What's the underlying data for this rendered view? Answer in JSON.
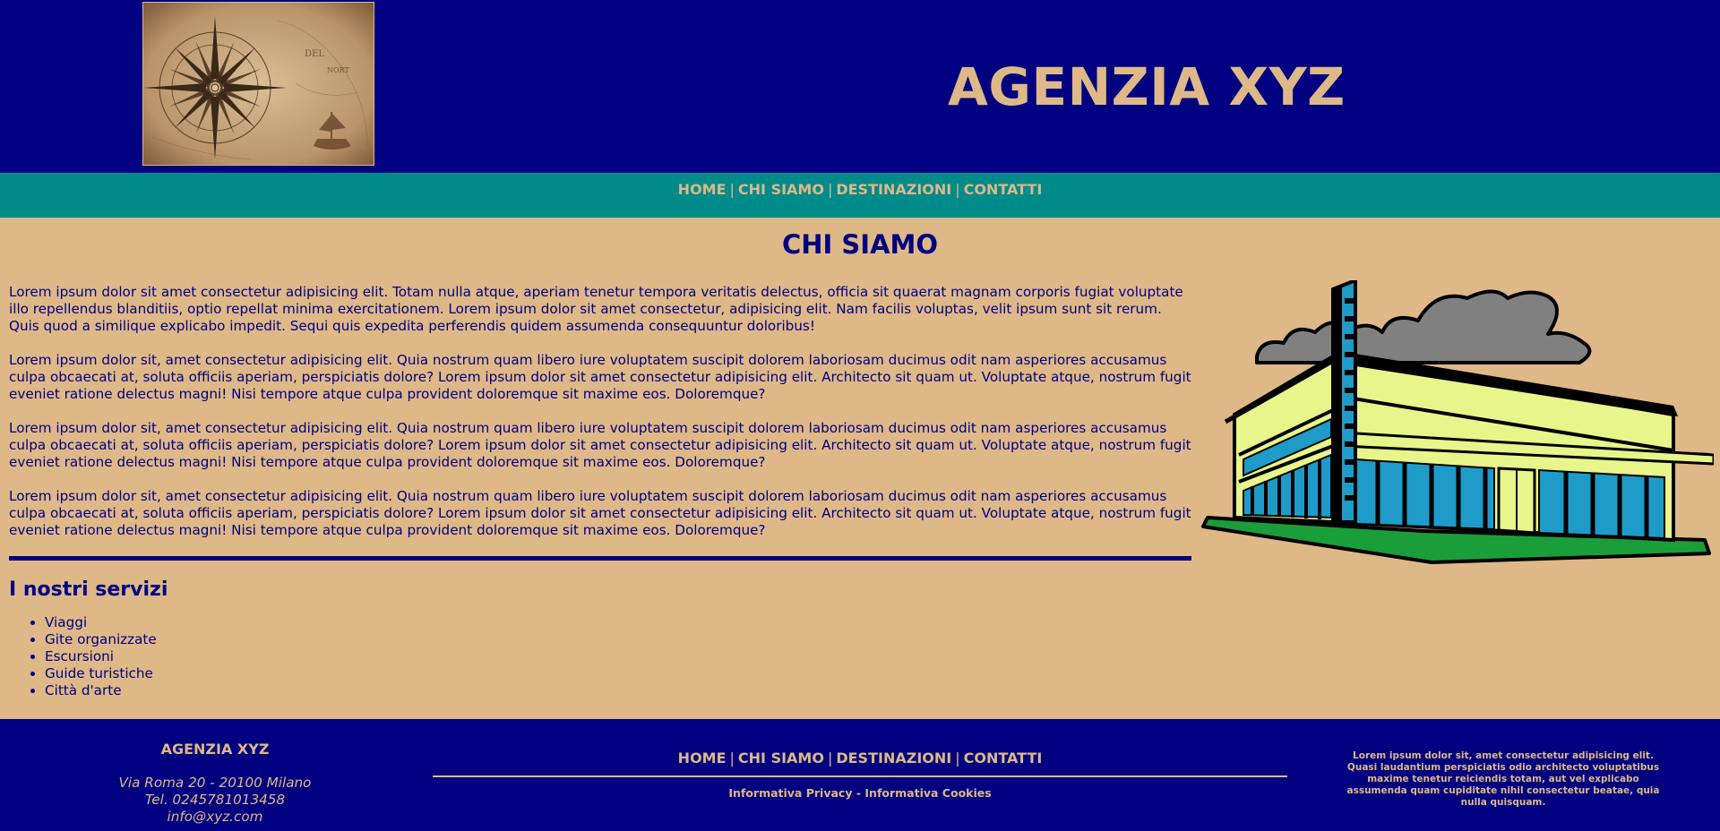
{
  "header": {
    "logo_icon": "compass-rose-map-image",
    "title": "AGENZIA XYZ"
  },
  "nav": {
    "home": "HOME",
    "about": "CHI SIAMO",
    "destinations": "DESTINAZIONI",
    "contacts": "CONTATTI",
    "separator": "|"
  },
  "main": {
    "heading": "CHI SIAMO",
    "paragraphs": [
      "Lorem ipsum dolor sit amet consectetur adipisicing elit. Totam nulla atque, aperiam tenetur tempora veritatis delectus, officia sit quaerat magnam corporis fugiat voluptate illo repellendus blanditiis, optio repellat minima exercitationem. Lorem ipsum dolor sit amet consectetur, adipisicing elit. Nam facilis voluptas, velit ipsum sunt sit rerum. Quis quod a similique explicabo impedit. Sequi quis expedita perferendis quidem assumenda consequuntur doloribus!",
      "Lorem ipsum dolor sit, amet consectetur adipisicing elit. Quia nostrum quam libero iure voluptatem suscipit dolorem laboriosam ducimus odit nam asperiores accusamus culpa obcaecati at, soluta officiis aperiam, perspiciatis dolore? Lorem ipsum dolor sit amet consectetur adipisicing elit. Architecto sit quam ut. Voluptate atque, nostrum fugit eveniet ratione delectus magni! Nisi tempore atque culpa provident doloremque sit maxime eos. Doloremque?",
      "Lorem ipsum dolor sit, amet consectetur adipisicing elit. Quia nostrum quam libero iure voluptatem suscipit dolorem laboriosam ducimus odit nam asperiores accusamus culpa obcaecati at, soluta officiis aperiam, perspiciatis dolore? Lorem ipsum dolor sit amet consectetur adipisicing elit. Architecto sit quam ut. Voluptate atque, nostrum fugit eveniet ratione delectus magni! Nisi tempore atque culpa provident doloremque sit maxime eos. Doloremque?",
      "Lorem ipsum dolor sit, amet consectetur adipisicing elit. Quia nostrum quam libero iure voluptatem suscipit dolorem laboriosam ducimus odit nam asperiores accusamus culpa obcaecati at, soluta officiis aperiam, perspiciatis dolore? Lorem ipsum dolor sit amet consectetur adipisicing elit. Architecto sit quam ut. Voluptate atque, nostrum fugit eveniet ratione delectus magni! Nisi tempore atque culpa provident doloremque sit maxime eos. Doloremque?"
    ],
    "services_title": "I nostri servizi",
    "services": [
      "Viaggi",
      "Gite organizzate",
      "Escursioni",
      "Guide turistiche",
      "Città d'arte"
    ],
    "illustration_icon": "building-illustration"
  },
  "footer": {
    "company": "AGENZIA XYZ",
    "address": "Via Roma 20 - 20100 Milano",
    "phone": "Tel. 0245781013458",
    "email": "info@xyz.com",
    "nav": {
      "home": "HOME",
      "about": "CHI SIAMO",
      "destinations": "DESTINAZIONI",
      "contacts": "CONTATTI"
    },
    "privacy": "Informativa Privacy",
    "legal_separator": "-",
    "cookies": "Informativa Cookies",
    "blurb": "Lorem ipsum dolor sit, amet consectetur adipisicing elit. Quasi laudantium perspiciatis odio architecto voluptatibus maxime tenetur reiciendis totam, aut vel explicabo assumenda quam cupiditate nihil consectetur beatae, quia nulla quisquam."
  },
  "colors": {
    "navy": "#000080",
    "teal": "#008B8B",
    "tan": "#DEB887"
  }
}
